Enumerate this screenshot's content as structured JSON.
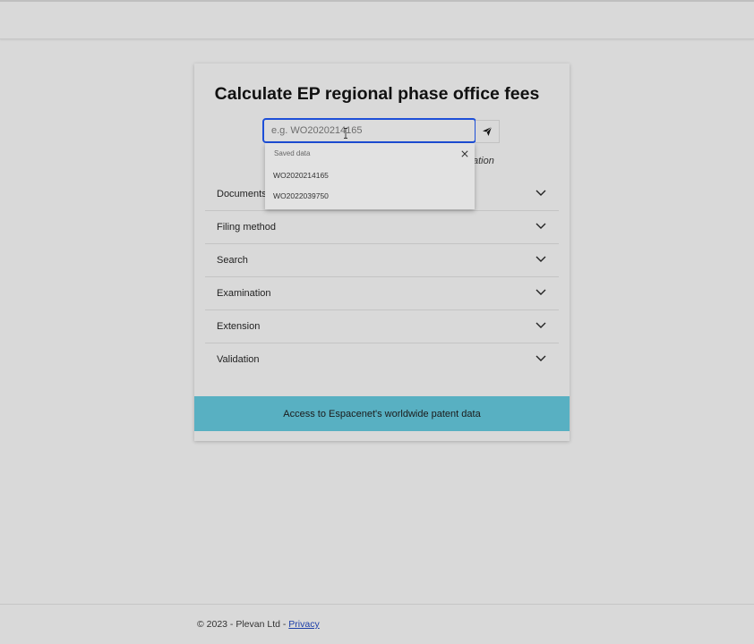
{
  "page": {
    "title": "Calculate EP regional phase office fees"
  },
  "search": {
    "placeholder": "e.g. WO2020214165",
    "value": "",
    "hint_fragment": "ation"
  },
  "dropdown": {
    "header": "Saved data",
    "items": [
      "WO2020214165",
      "WO2022039750"
    ]
  },
  "accordion": {
    "items": [
      {
        "label": "Documents"
      },
      {
        "label": "Filing method"
      },
      {
        "label": "Search"
      },
      {
        "label": "Examination"
      },
      {
        "label": "Extension"
      },
      {
        "label": "Validation"
      }
    ]
  },
  "banner": {
    "label": "Access to Espacenet's worldwide patent data"
  },
  "footer": {
    "copyright": "© 2023 - Plevan Ltd - ",
    "privacy_link": "Privacy"
  },
  "colors": {
    "background": "#d9d9d9",
    "accent_border": "#1d4fd8",
    "banner": "#58b0c2",
    "link": "#1d3fa8"
  },
  "icons": {
    "submit": "paper-plane-icon",
    "close": "close-icon",
    "chevron": "chevron-down-icon"
  }
}
